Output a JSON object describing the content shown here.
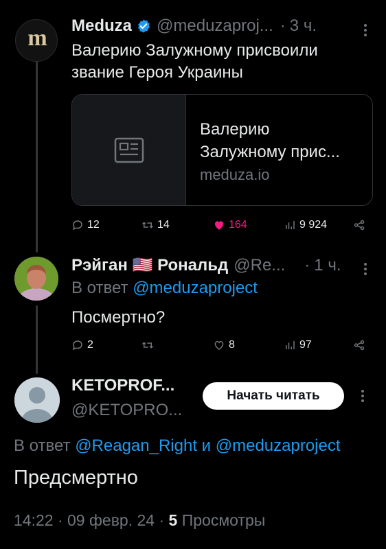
{
  "tweet1": {
    "name": "Meduza",
    "handle": "@meduzaproj...",
    "time": "3 ч.",
    "text_line1": "Валерию Залужному присвоили",
    "text_line2": "звание Героя Украины",
    "card": {
      "title_line1": "Валерию",
      "title_line2": "Залужному прис...",
      "domain": "meduza.io"
    },
    "stats": {
      "replies": "12",
      "retweets": "14",
      "likes": "164",
      "views": "9 924"
    },
    "colors": {
      "like": "#f91880",
      "verified": "#1d9bf0"
    }
  },
  "tweet2": {
    "name_part1": "Рэйган",
    "flag": "🇺🇸",
    "name_part2": "Рональд",
    "handle": "@Re...",
    "time": "1 ч.",
    "reply_prefix": "В ответ",
    "reply_mention": "@meduzaproject",
    "text": "Посмертно?",
    "stats": {
      "replies": "2",
      "retweets": "",
      "likes": "8",
      "views": "97"
    }
  },
  "tweet3": {
    "name": "KETOPROF...",
    "handle": "@KETOPRO...",
    "follow_button": "Начать читать",
    "reply_prefix": "В ответ",
    "reply_mention1": "@Reagan_Right",
    "reply_and": "и",
    "reply_mention2": "@meduzaproject",
    "text": "Предсмертно",
    "time": "14:22",
    "date": "09 февр. 24",
    "views_count": "5",
    "views_label": "Просмотры"
  },
  "separator": "·"
}
